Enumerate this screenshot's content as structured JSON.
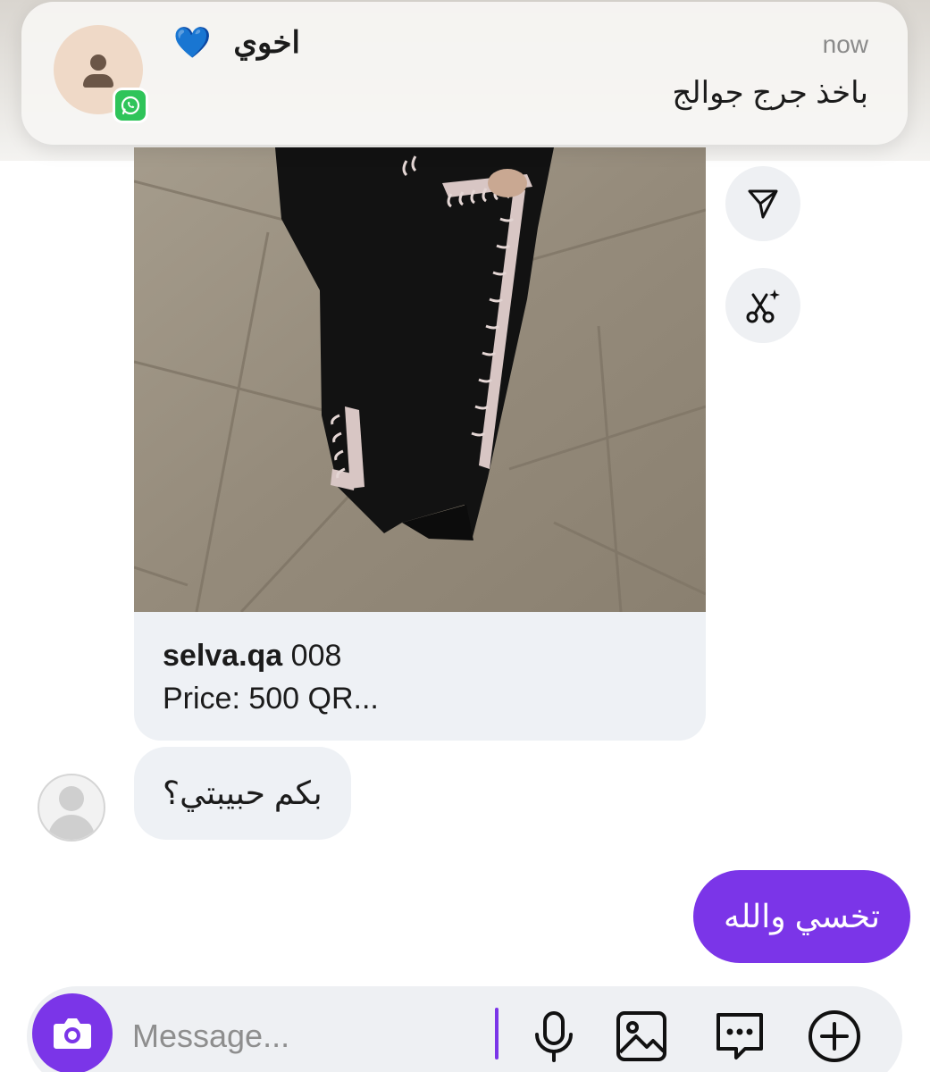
{
  "notification": {
    "sender_name": "اخوي",
    "heart_emoji": "💙",
    "time": "now",
    "message": "باخذ جرج جوالج",
    "app_icon": "whatsapp-icon",
    "avatar_icon": "person-icon"
  },
  "shared_post": {
    "username": "selva.qa",
    "code": "008",
    "price_line": "Price: 500 QR...",
    "image": "black abaya with white embroidered trim on tiled floor"
  },
  "side_actions": {
    "share_icon": "send-icon",
    "remix_icon": "scissors-sparkle-icon"
  },
  "messages": {
    "incoming": "بكم حبيبتي؟",
    "outgoing": "تخسي والله"
  },
  "composer": {
    "placeholder": "Message...",
    "value": "",
    "icons": [
      "camera-icon",
      "microphone-icon",
      "gallery-icon",
      "sticker-icon",
      "plus-icon"
    ]
  },
  "colors": {
    "accent": "#7b35e8",
    "bubble_incoming": "#eef1f5",
    "whatsapp": "#2fc45a"
  }
}
